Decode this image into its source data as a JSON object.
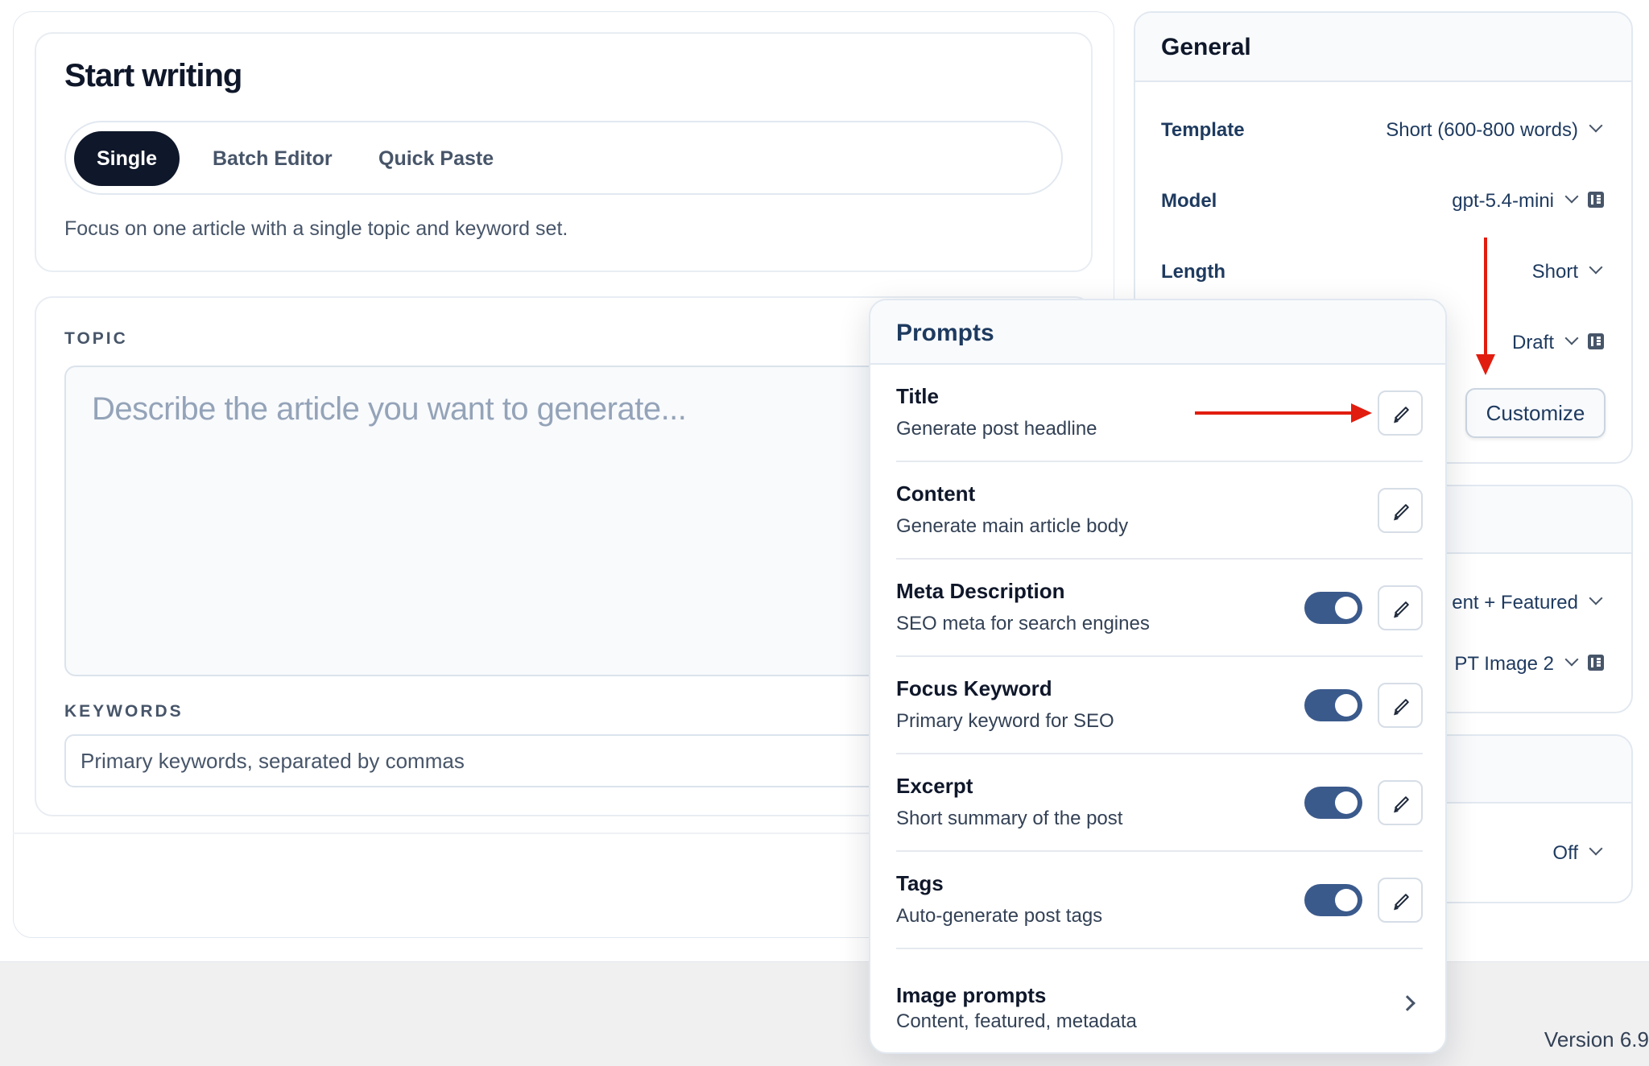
{
  "start": {
    "title": "Start writing",
    "tabs": [
      "Single",
      "Batch Editor",
      "Quick Paste"
    ],
    "active_tab": "Single",
    "description": "Focus on one article with a single topic and keyword set."
  },
  "topic": {
    "label": "TOPIC",
    "placeholder": "Describe the article you want to generate..."
  },
  "keywords": {
    "label": "KEYWORDS",
    "placeholder": "Primary keywords, separated by commas"
  },
  "general": {
    "title": "General",
    "rows": [
      {
        "label": "Template",
        "value": "Short (600-800 words)"
      },
      {
        "label": "Model",
        "value": "gpt-5.4-mini"
      },
      {
        "label": "Length",
        "value": "Short"
      },
      {
        "label": "",
        "value": "Draft"
      }
    ],
    "customize_label": "Customize"
  },
  "image_settings": {
    "visible_values": [
      "ent + Featured",
      "PT Image 2"
    ]
  },
  "third_settings": {
    "visible_value": "Off"
  },
  "prompts": {
    "title": "Prompts",
    "items": [
      {
        "name": "Title",
        "desc": "Generate post headline",
        "toggle": null
      },
      {
        "name": "Content",
        "desc": "Generate main article body",
        "toggle": null
      },
      {
        "name": "Meta Description",
        "desc": "SEO meta for search engines",
        "toggle": true
      },
      {
        "name": "Focus Keyword",
        "desc": "Primary keyword for SEO",
        "toggle": true
      },
      {
        "name": "Excerpt",
        "desc": "Short summary of the post",
        "toggle": true
      },
      {
        "name": "Tags",
        "desc": "Auto-generate post tags",
        "toggle": true
      }
    ],
    "image_prompts": {
      "name": "Image prompts",
      "desc": "Content, featured, metadata"
    }
  },
  "footer": {
    "version": "Version 6.9"
  },
  "colors": {
    "accent_dark": "#0f172a",
    "toggle_on": "#3b5a8c",
    "annotation_red": "#e11d0f"
  },
  "icons": [
    "chevron-down-icon",
    "settings-sliders-icon",
    "pencil-icon",
    "chevron-right-icon",
    "arrow-annotation"
  ]
}
